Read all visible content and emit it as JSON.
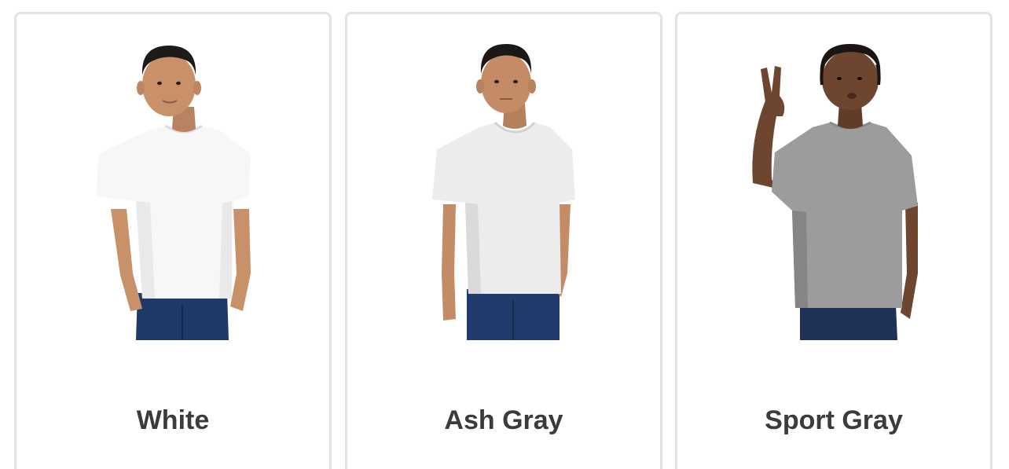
{
  "swatches": [
    {
      "label": "White",
      "image_icon": "boy-white-tshirt-photo",
      "colors": {
        "shirt": "#f7f7f7",
        "shirt_shade": "#e9e9e9",
        "jeans": "#1f3a68",
        "skin": "#c9916a",
        "hair": "#1e1a18"
      }
    },
    {
      "label": "Ash Gray",
      "image_icon": "boy-ash-gray-tshirt-photo",
      "colors": {
        "shirt": "#ececec",
        "shirt_shade": "#dadada",
        "jeans": "#203c6c",
        "skin": "#c48c66",
        "hair": "#1c1816"
      }
    },
    {
      "label": "Sport Gray",
      "image_icon": "child-sport-gray-tshirt-photo",
      "colors": {
        "shirt": "#9c9c9c",
        "shirt_shade": "#858585",
        "jeans": "#1f3358",
        "skin": "#6e4630",
        "hair": "#1a1412"
      }
    }
  ],
  "theme": {
    "border": "#e3e3e3",
    "label_color": "#3b3b3b",
    "background": "#ffffff"
  }
}
